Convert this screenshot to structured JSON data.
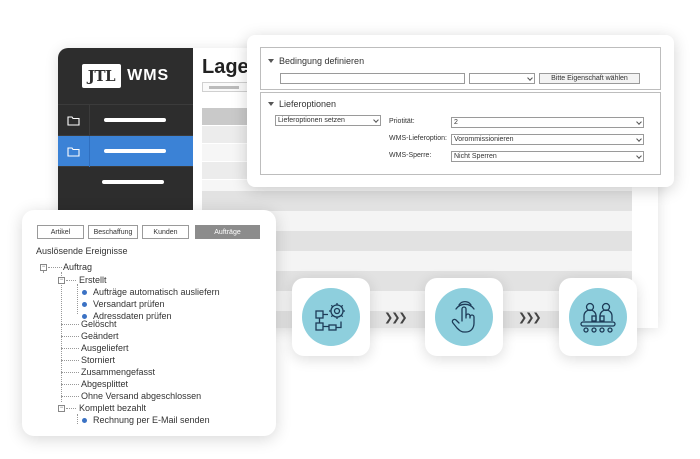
{
  "app": {
    "logo_mark": "JTL",
    "logo_text": "WMS",
    "page_title": "Lager"
  },
  "dialog": {
    "bedingung": {
      "title": "Bedingung definieren",
      "field1_value": "",
      "field2_value": "",
      "button_label": "Bitte Eigenschaft wählen"
    },
    "lieferoptionen": {
      "title": "Lieferoptionen",
      "action_select": "Lieferoptionen setzen",
      "prioritaet_label": "Priotität:",
      "prioritaet_value": "2",
      "wms_lieferoption_label": "WMS-Lieferoption:",
      "wms_lieferoption_value": "Vorommissionieren",
      "wms_sperre_label": "WMS-Sperre:",
      "wms_sperre_value": "Nicht Sperren"
    }
  },
  "tree_panel": {
    "tabs": [
      "Artikel",
      "Beschaffung",
      "Kunden",
      "Aufträge"
    ],
    "active_tab": "Aufträge",
    "title": "Auslösende Ereignisse",
    "nodes": {
      "auftrag": "Auftrag",
      "erstellt": "Erstellt",
      "erstellt_children": [
        "Aufträge automatisch ausliefern",
        "Versandart prüfen",
        "Adressdaten prüfen"
      ],
      "events": [
        "Gelöscht",
        "Geändert",
        "Ausgeliefert",
        "Storniert",
        "Zusammengefasst",
        "Abgesplittet",
        "Ohne Versand abgeschlossen"
      ],
      "komplett": "Komplett bezahlt",
      "komplett_children": [
        "Rechnung per E-Mail senden"
      ]
    }
  },
  "process": {
    "icons": [
      "workflow-settings-icon",
      "touch-hand-icon",
      "conveyor-workers-icon"
    ],
    "arrow_glyphs": "❯❯❯",
    "accent": "#8ecfdd"
  },
  "colors": {
    "sidebar": "#2d2d2d",
    "active_nav": "#3b82d6",
    "tree_dot": "#3b72c4"
  }
}
